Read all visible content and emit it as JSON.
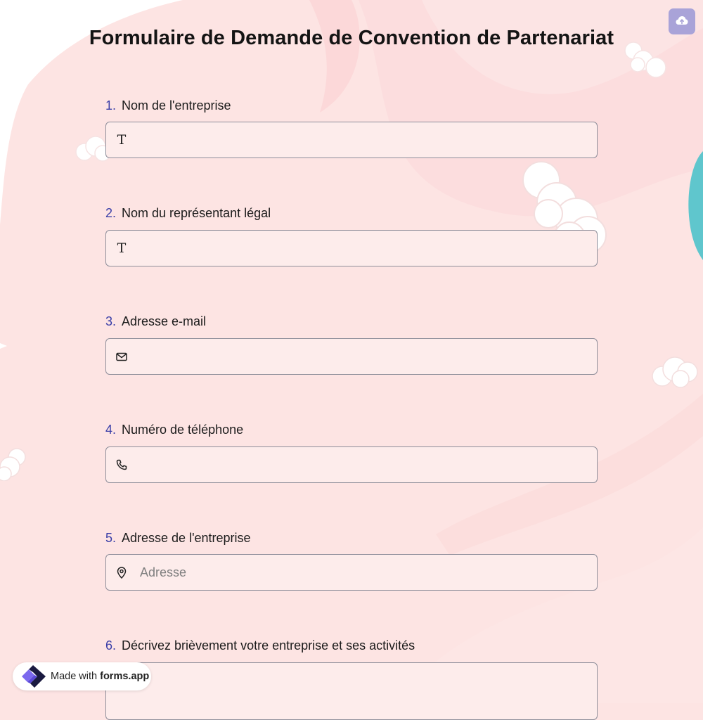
{
  "form": {
    "title": "Formulaire de Demande de Convention de Partenariat",
    "questions": [
      {
        "number": "1.",
        "label": "Nom de l'entreprise",
        "icon": "text-icon",
        "placeholder": ""
      },
      {
        "number": "2.",
        "label": "Nom du représentant légal",
        "icon": "text-icon",
        "placeholder": ""
      },
      {
        "number": "3.",
        "label": "Adresse e-mail",
        "icon": "mail-icon",
        "placeholder": ""
      },
      {
        "number": "4.",
        "label": "Numéro de téléphone",
        "icon": "phone-icon",
        "placeholder": ""
      },
      {
        "number": "5.",
        "label": "Adresse de l'entreprise",
        "icon": "map-pin-icon",
        "placeholder": "Adresse"
      },
      {
        "number": "6.",
        "label": "Décrivez brièvement votre entreprise et ses activités",
        "icon": "",
        "placeholder": ""
      }
    ],
    "text_icon_glyph": "T"
  },
  "toolbar": {
    "save_icon": "cloud-upload-icon"
  },
  "footer": {
    "made_with": "Made with",
    "brand": "forms.app"
  },
  "colors": {
    "background": "#fde4e3",
    "accent_number": "#3b3fa8",
    "save_button": "#a9a3d8",
    "teal_circle": "#5fc6cd"
  }
}
